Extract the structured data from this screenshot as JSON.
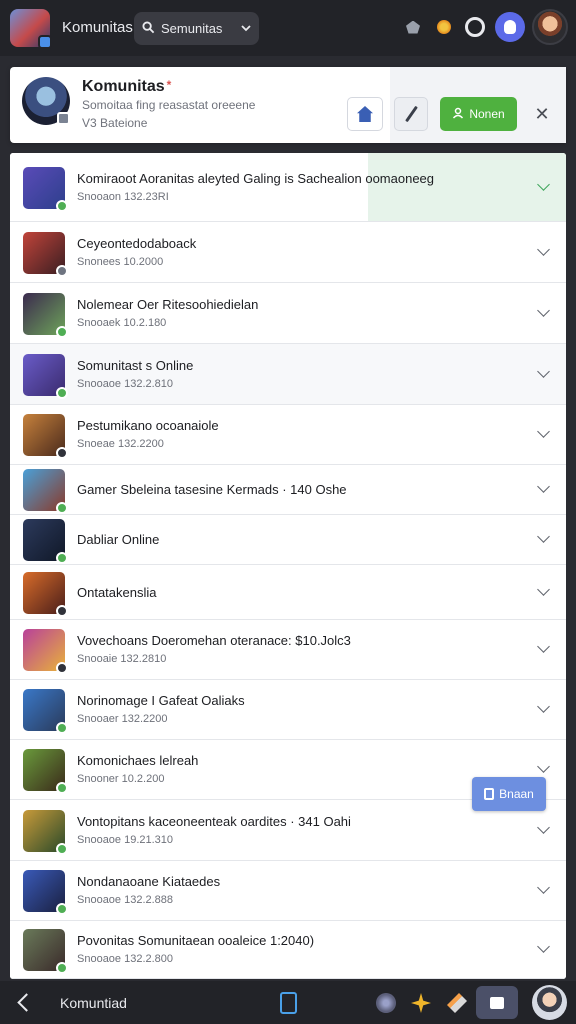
{
  "topbar": {
    "app_title": "Komunitas",
    "search_label": "Semunitas",
    "icons": [
      "pentagon-icon",
      "flame-icon",
      "ring-icon",
      "discord-icon"
    ]
  },
  "header": {
    "title": "Komunitas",
    "required_mark": "*",
    "subtitle_1": "Somoitaa fing reasastat oreeene",
    "subtitle_2": "V3 Bateione",
    "join_label": "Nonen",
    "close_label": "✕"
  },
  "communities": [
    {
      "name": "Komiraoot Aoranitas aleyted Galing is Sachealion oomaoneeg",
      "meta": "Snooaon 132.23RI",
      "colors": [
        "#5a4bb8",
        "#2d3f8c"
      ],
      "pip": "#4fae54",
      "highlight": true
    },
    {
      "name": "Ceyeontedodaboack",
      "meta": "Snonees 10.2000",
      "colors": [
        "#c1443a",
        "#3a1e22"
      ],
      "pip": "#6e7480"
    },
    {
      "name": "Nolemear Oer Ritesoohiedielan",
      "meta": "Snooaek 10.2.180",
      "colors": [
        "#3b2a4e",
        "#6ea45a"
      ],
      "pip": "#4fae54"
    },
    {
      "name": "Somunitast s Online",
      "meta": "Snooaoe 132.2.810",
      "colors": [
        "#6a5cc8",
        "#3a2b6e"
      ],
      "pip": "#4fae54"
    },
    {
      "name": "Pestumikano ocoanaiole",
      "meta": "Snoeae 132.2200",
      "colors": [
        "#c6813c",
        "#4a2a1c"
      ],
      "pip": "#30323a"
    },
    {
      "name": "Gamer Sbeleina tasesine Kermads · 140 Oshe",
      "meta": "",
      "colors": [
        "#4aa0d8",
        "#8a3a2a"
      ],
      "pip": "#4fae54"
    },
    {
      "name": "Dabliar Online",
      "meta": "",
      "colors": [
        "#2c3a5c",
        "#101828"
      ],
      "pip": "#4fae54"
    },
    {
      "name": "Ontatakenslia",
      "meta": "",
      "colors": [
        "#d86c2a",
        "#4a1e1a"
      ],
      "pip": "#30323a"
    },
    {
      "name": "Vovechoans Doeromehan oteranace: $10.Jolc3",
      "meta": "Snooaie 132.2810",
      "colors": [
        "#b8419a",
        "#e8b23a"
      ],
      "pip": "#30323a"
    },
    {
      "name": "Norinomage I Gafeat Oaliaks",
      "meta": "Snooaer 132.2200",
      "colors": [
        "#3a78c8",
        "#2a3a5a"
      ],
      "pip": "#4fae54"
    },
    {
      "name": "Komonichaes lelreah",
      "meta": "Snooner 10.2.200",
      "colors": [
        "#6a9a3c",
        "#3a2a1a"
      ],
      "pip": "#4fae54"
    },
    {
      "name": "Vontopitans kaceoneenteak oardites · 341 Oahi",
      "meta": "Snooaoe 19.21.310",
      "colors": [
        "#c89a3a",
        "#2a4a2a"
      ],
      "pip": "#4fae54"
    },
    {
      "name": "Nondanaoane Kiataedes",
      "meta": "Snooaoe 132.2.888",
      "colors": [
        "#3a5ab8",
        "#1a2040"
      ],
      "pip": "#4fae54"
    },
    {
      "name": "Povonitas Somunitaean ooaleice 1:2040)",
      "meta": "Snooaoe 132.2.800",
      "colors": [
        "#6a7a5a",
        "#3a2a2a"
      ],
      "pip": "#4fae54"
    }
  ],
  "fab": {
    "label": "Bnaan"
  },
  "bottombar": {
    "title": "Komuntiad"
  },
  "colors": {
    "accent_green": "#4fb13f",
    "accent_blue": "#6d8fe0",
    "chrome": "#222328"
  }
}
